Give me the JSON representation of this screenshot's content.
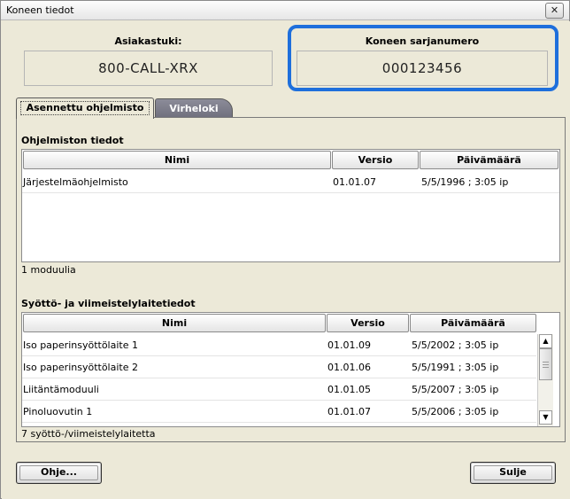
{
  "window": {
    "title": "Koneen tiedot",
    "close_label": "✕"
  },
  "support": {
    "label": "Asiakastuki:",
    "value": "800-CALL-XRX"
  },
  "serial": {
    "label": "Koneen sarjanumero",
    "value": "000123456"
  },
  "tabs": [
    {
      "label": "Asennettu ohjelmisto",
      "active": true
    },
    {
      "label": "Virheloki",
      "active": false
    }
  ],
  "software": {
    "section_title": "Ohjelmiston tiedot",
    "columns": [
      "Nimi",
      "Versio",
      "Päivämäärä"
    ],
    "rows": [
      {
        "name": "Järjestelmäohjelmisto",
        "version": "01.01.07",
        "date": "5/5/1996 ; 3:05 ip"
      }
    ],
    "count_text": "1 moduulia"
  },
  "devices": {
    "section_title": "Syöttö- ja viimeistelylaitetiedot",
    "columns": [
      "Nimi",
      "Versio",
      "Päivämäärä"
    ],
    "rows": [
      {
        "name": "Iso paperinsyöttölaite 1",
        "version": "01.01.09",
        "date": "5/5/2002 ; 3:05 ip"
      },
      {
        "name": "Iso paperinsyöttölaite 2",
        "version": "01.01.06",
        "date": "5/5/1991 ; 3:05 ip"
      },
      {
        "name": "Liitäntämoduuli",
        "version": "01.01.05",
        "date": "5/5/2007 ; 3:05 ip"
      },
      {
        "name": "Pinoluovutin 1",
        "version": "01.01.07",
        "date": "5/5/2006 ; 3:05 ip"
      }
    ],
    "count_text": "7 syöttö-/viimeistelylaitetta",
    "scroll_up_icon": "▲",
    "scroll_down_icon": "▼"
  },
  "buttons": {
    "help": "Ohje...",
    "close": "Sulje"
  },
  "colors": {
    "highlight": "#1e6fdc",
    "inactive_tab": "#7b7b88"
  }
}
